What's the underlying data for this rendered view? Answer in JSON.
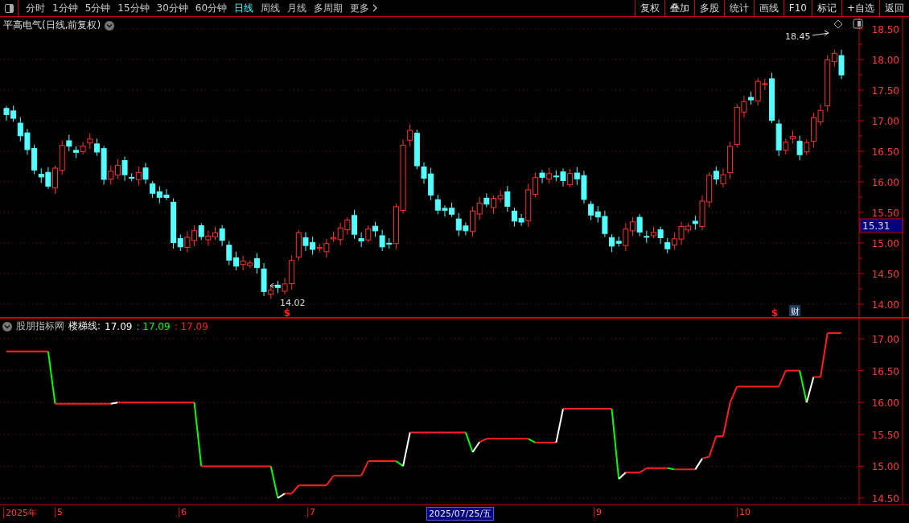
{
  "toolbar": {
    "periods": [
      {
        "label": "分时",
        "selected": false
      },
      {
        "label": "1分钟",
        "selected": false
      },
      {
        "label": "5分钟",
        "selected": false
      },
      {
        "label": "15分钟",
        "selected": false
      },
      {
        "label": "30分钟",
        "selected": false
      },
      {
        "label": "60分钟",
        "selected": false
      },
      {
        "label": "日线",
        "selected": true
      },
      {
        "label": "周线",
        "selected": false
      },
      {
        "label": "月线",
        "selected": false
      },
      {
        "label": "多周期",
        "selected": false
      }
    ],
    "more": "更多",
    "actions": [
      "复权",
      "叠加",
      "多股",
      "统计",
      "画线",
      "F10",
      "标记",
      "+自选",
      "返回"
    ]
  },
  "price_chart": {
    "title": "平高电气(日线,前复权)",
    "yticks": [
      "18.50",
      "18.00",
      "17.50",
      "17.00",
      "16.50",
      "16.00",
      "15.50",
      "15.00",
      "14.50",
      "14.00"
    ],
    "current_price": "15.31",
    "high_label": "18.45",
    "low_label": "14.02",
    "markers": [
      {
        "text": "$",
        "kind": "dividend"
      },
      {
        "text": "$",
        "kind": "dividend"
      },
      {
        "text": "财",
        "kind": "report"
      }
    ]
  },
  "indicator": {
    "source": "股朋指标网",
    "name": "楼梯线:",
    "values": [
      {
        "text": "17.09",
        "color": "#ffffff"
      },
      {
        "text": ": 17.09",
        "color": "#00ff00"
      },
      {
        "text": ": 17.09",
        "color": "#ff2020"
      }
    ],
    "yticks": [
      "17.00",
      "16.50",
      "16.00",
      "15.50",
      "15.00",
      "14.50"
    ]
  },
  "date_axis": [
    {
      "label": "2025年",
      "highlighted": false
    },
    {
      "label": "5",
      "highlighted": false
    },
    {
      "label": "6",
      "highlighted": false
    },
    {
      "label": "7",
      "highlighted": false
    },
    {
      "label": "2025/07/25/五",
      "highlighted": true
    },
    {
      "label": "9",
      "highlighted": false
    },
    {
      "label": "10",
      "highlighted": false
    }
  ]
}
